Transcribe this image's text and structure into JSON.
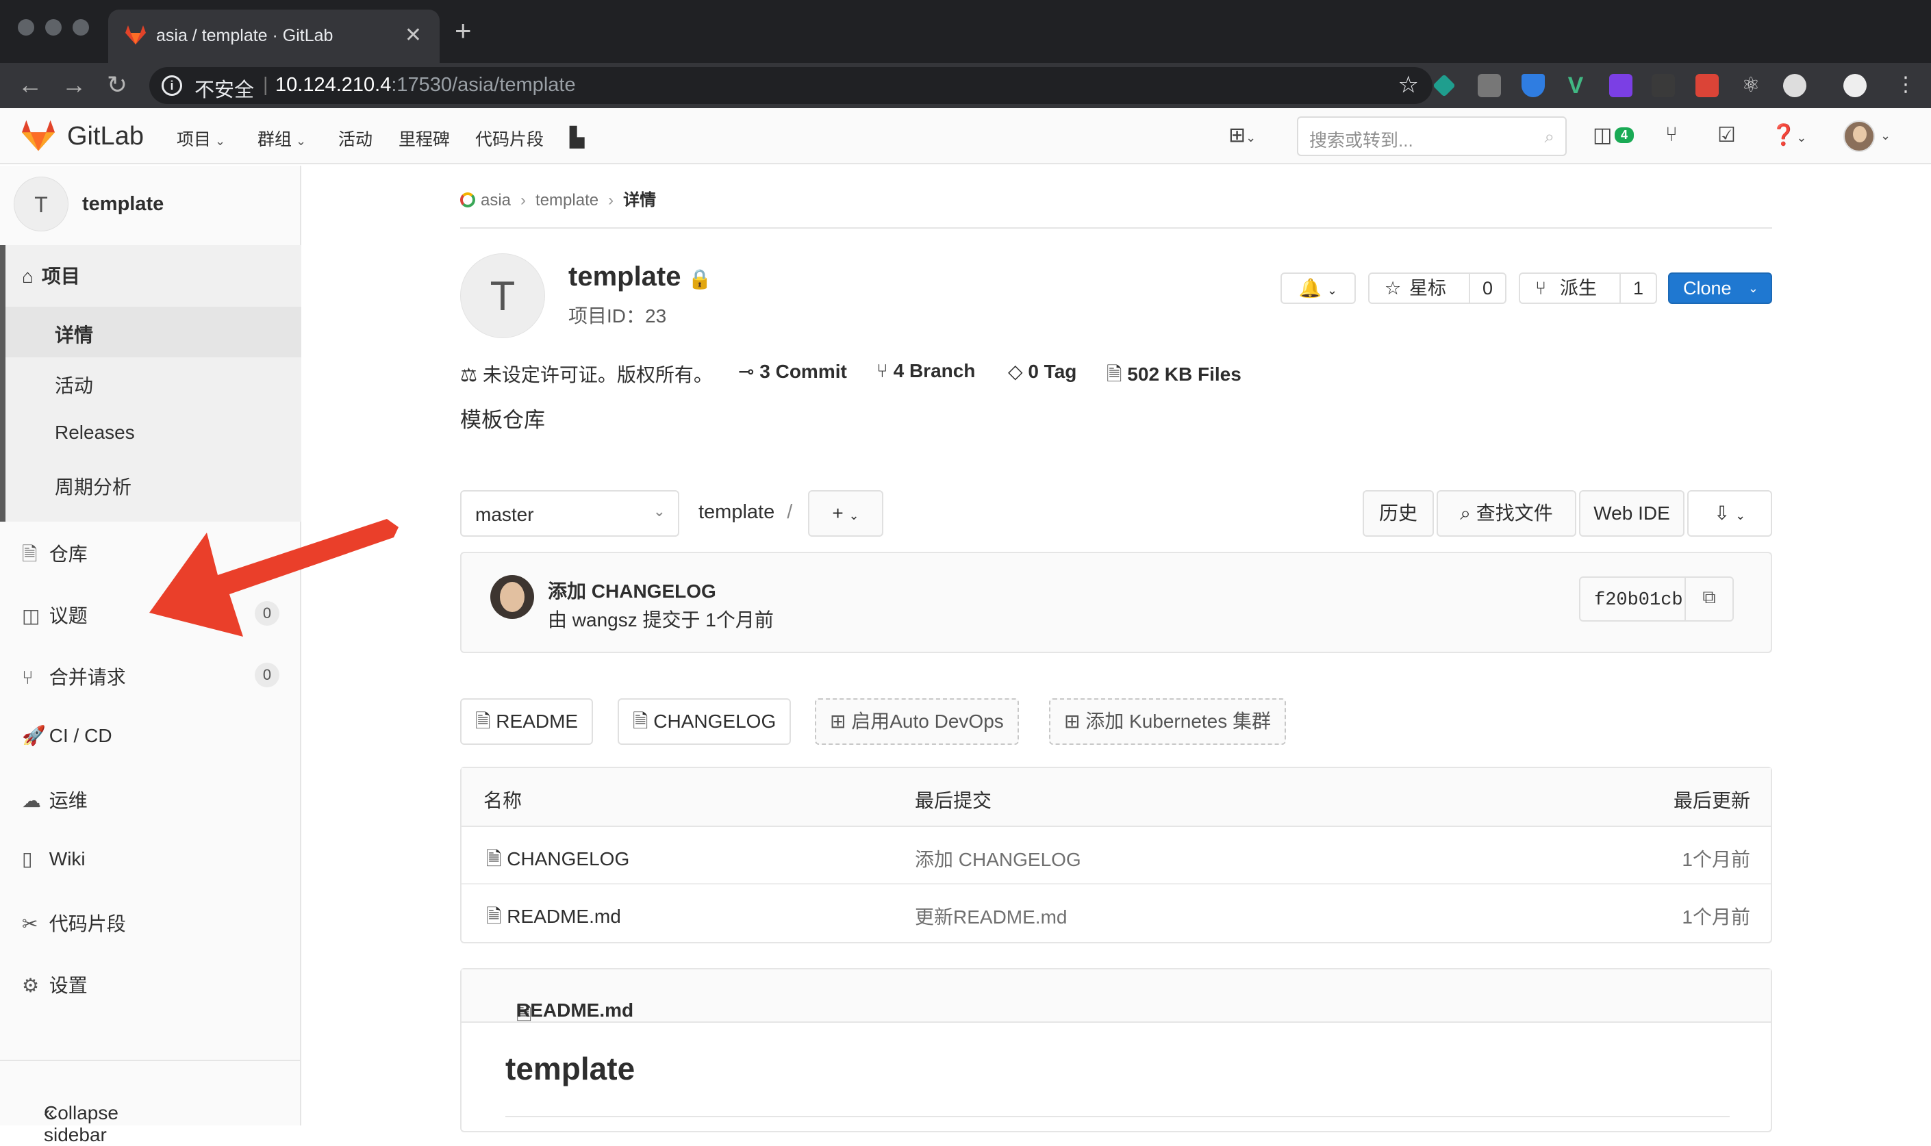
{
  "browser": {
    "tab_title": "asia / template · GitLab",
    "insecure_label": "不安全",
    "url_host": "10.124.210.4",
    "url_rest": ":17530/asia/template"
  },
  "gitlab_nav": {
    "brand": "GitLab",
    "items": [
      "项目",
      "群组",
      "活动",
      "里程碑",
      "代码片段"
    ],
    "search_placeholder": "搜索或转到...",
    "issues_badge": "4"
  },
  "sidebar": {
    "project_avatar": "T",
    "project_name": "template",
    "project_section": "项目",
    "sub_items": [
      "详情",
      "活动",
      "Releases",
      "周期分析"
    ],
    "items": [
      {
        "label": "仓库",
        "icon": "repository-icon"
      },
      {
        "label": "议题",
        "icon": "issues-icon",
        "count": "0"
      },
      {
        "label": "合并请求",
        "icon": "merge-request-icon",
        "count": "0"
      },
      {
        "label": "CI / CD",
        "icon": "rocket-icon"
      },
      {
        "label": "运维",
        "icon": "cloud-gear-icon"
      },
      {
        "label": "Wiki",
        "icon": "book-icon"
      },
      {
        "label": "代码片段",
        "icon": "snippet-icon"
      },
      {
        "label": "设置",
        "icon": "gear-icon"
      }
    ],
    "collapse_label": "Collapse sidebar"
  },
  "breadcrumb": [
    "asia",
    "template",
    "详情"
  ],
  "project": {
    "avatar": "T",
    "title": "template",
    "id_label": "项目ID：23",
    "star_label": "星标",
    "star_count": "0",
    "fork_label": "派生",
    "fork_count": "1",
    "clone_label": "Clone",
    "license": "未设定许可证。版权所有。",
    "commits": "3 Commit",
    "branches": "4 Branch",
    "tags": "0 Tag",
    "files": "502 KB Files",
    "description": "模板仓库"
  },
  "repo_toolbar": {
    "branch": "master",
    "path": "template",
    "path_sep": "/",
    "history": "历史",
    "find_file": "查找文件",
    "web_ide": "Web IDE"
  },
  "last_commit": {
    "message": "添加 CHANGELOG",
    "meta": "由 wangsz 提交于 1个月前",
    "sha": "f20b01cb"
  },
  "quick_buttons": [
    "README",
    "CHANGELOG",
    "启用Auto DevOps",
    "添加 Kubernetes 集群"
  ],
  "file_table": {
    "headers": [
      "名称",
      "最后提交",
      "最后更新"
    ],
    "rows": [
      {
        "name": "CHANGELOG",
        "commit": "添加 CHANGELOG",
        "updated": "1个月前"
      },
      {
        "name": "README.md",
        "commit": "更新README.md",
        "updated": "1个月前"
      }
    ]
  },
  "readme": {
    "file": "README.md",
    "heading": "template"
  },
  "colors": {
    "clone_blue": "#1f78d1",
    "annotation_arrow": "#ea3f2a",
    "gitlab_orange": "#e24329"
  }
}
